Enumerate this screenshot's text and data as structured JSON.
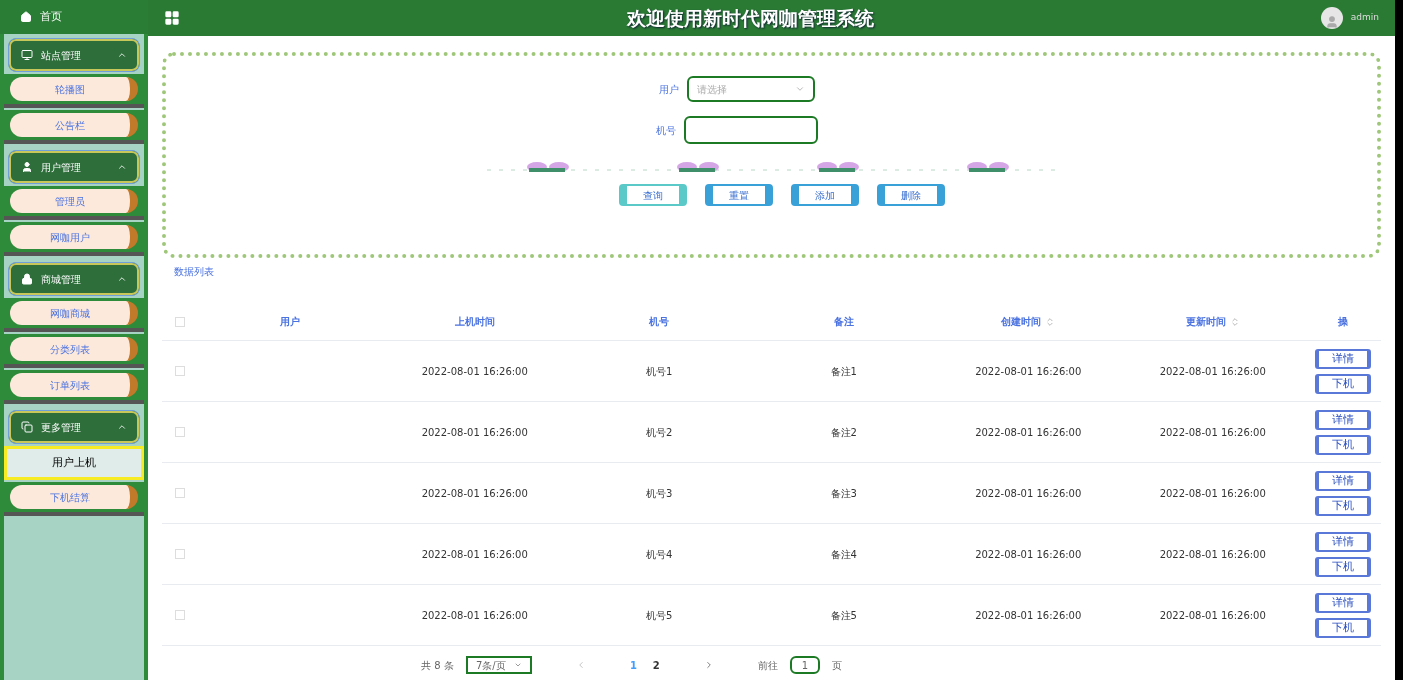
{
  "header": {
    "title": "欢迎使用新时代网咖管理系统",
    "user": "admin"
  },
  "sidebar": {
    "home": {
      "label": "首页"
    },
    "groups": [
      {
        "label": "站点管理",
        "expanded": true,
        "items": [
          {
            "label": "轮播图",
            "selected": false
          },
          {
            "label": "公告栏",
            "selected": false
          }
        ]
      },
      {
        "label": "用户管理",
        "expanded": true,
        "items": [
          {
            "label": "管理员",
            "selected": false
          },
          {
            "label": "网咖用户",
            "selected": false
          }
        ]
      },
      {
        "label": "商城管理",
        "expanded": true,
        "items": [
          {
            "label": "网咖商城",
            "selected": false
          },
          {
            "label": "分类列表",
            "selected": false
          },
          {
            "label": "订单列表",
            "selected": false
          }
        ]
      },
      {
        "label": "更多管理",
        "expanded": true,
        "items": [
          {
            "label": "用户上机",
            "selected": true
          },
          {
            "label": "下机结算",
            "selected": false
          }
        ]
      }
    ]
  },
  "search": {
    "fields": [
      {
        "label": "用户",
        "kind": "select",
        "placeholder": "请选择"
      },
      {
        "label": "机号",
        "kind": "input"
      }
    ],
    "buttons": [
      "查询",
      "重置",
      "添加",
      "删除"
    ]
  },
  "table": {
    "title": "数据列表",
    "header_checked": false,
    "columns": [
      {
        "label": "用户",
        "sortable": false
      },
      {
        "label": "上机时间",
        "sortable": false
      },
      {
        "label": "机号",
        "sortable": false
      },
      {
        "label": "备注",
        "sortable": false
      },
      {
        "label": "创建时间",
        "sortable": true
      },
      {
        "label": "更新时间",
        "sortable": true
      },
      {
        "label": "操",
        "sortable": false
      }
    ],
    "rows": [
      {
        "checked": false,
        "cells": [
          "",
          "2022-08-01 16:26:00",
          "机号1",
          "备注1",
          "2022-08-01 16:26:00",
          "2022-08-01 16:26:00"
        ],
        "actions": [
          "详情",
          "下机"
        ]
      },
      {
        "checked": false,
        "cells": [
          "",
          "2022-08-01 16:26:00",
          "机号2",
          "备注2",
          "2022-08-01 16:26:00",
          "2022-08-01 16:26:00"
        ],
        "actions": [
          "详情",
          "下机"
        ]
      },
      {
        "checked": false,
        "cells": [
          "",
          "2022-08-01 16:26:00",
          "机号3",
          "备注3",
          "2022-08-01 16:26:00",
          "2022-08-01 16:26:00"
        ],
        "actions": [
          "详情",
          "下机"
        ]
      },
      {
        "checked": false,
        "cells": [
          "",
          "2022-08-01 16:26:00",
          "机号4",
          "备注4",
          "2022-08-01 16:26:00",
          "2022-08-01 16:26:00"
        ],
        "actions": [
          "详情",
          "下机"
        ]
      },
      {
        "checked": false,
        "cells": [
          "",
          "2022-08-01 16:26:00",
          "机号5",
          "备注5",
          "2022-08-01 16:26:00",
          "2022-08-01 16:26:00"
        ],
        "actions": [
          "详情",
          "下机"
        ]
      }
    ]
  },
  "pagination": {
    "total": "共 8 条",
    "page_size": "7条/页",
    "pages": [
      {
        "label": "1",
        "selected": true
      },
      {
        "label": "2",
        "selected": false
      }
    ],
    "goto_label": "前往",
    "goto_value": "1",
    "goto_suffix": "页"
  }
}
